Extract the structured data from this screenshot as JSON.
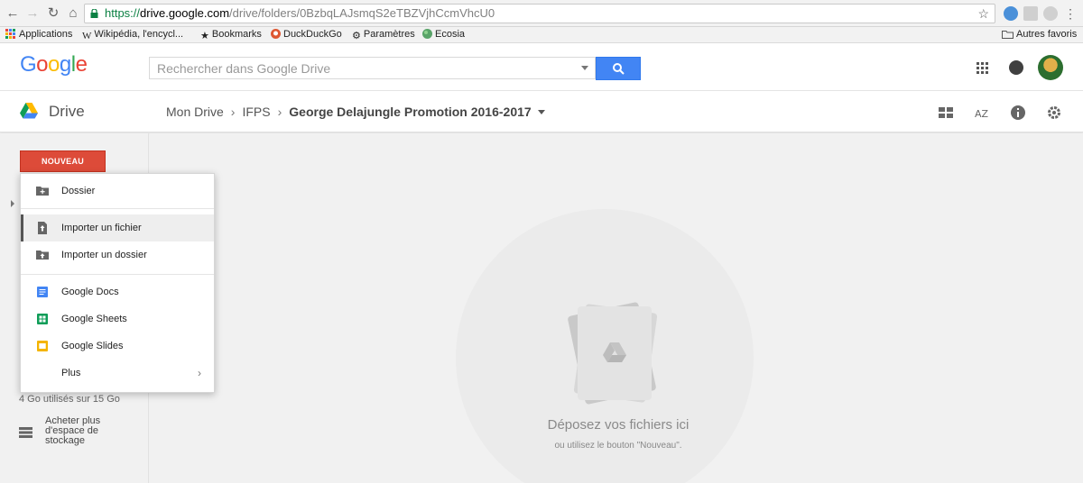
{
  "browser": {
    "url_proto": "https://",
    "url_host": "drive.google.com",
    "url_path": "/drive/folders/0BzbqLAJsmqS2eTBZVjhCcmVhcU0",
    "bookmarks": [
      "Applications",
      "Wikipédia, l'encycl...",
      "Bookmarks",
      "DuckDuckGo",
      "Paramètres",
      "Ecosia"
    ],
    "other_bookmarks": "Autres favoris"
  },
  "header": {
    "logo": "Google",
    "search_placeholder": "Rechercher dans Google Drive"
  },
  "drive": {
    "label": "Drive",
    "breadcrumb": [
      "Mon Drive",
      "IFPS",
      "George Delajungle Promotion 2016-2017"
    ]
  },
  "sidebar": {
    "new_button": "NOUVEAU",
    "storage": "4 Go utilisés sur 15 Go",
    "buy_storage": "Acheter plus d'espace de stockage"
  },
  "menu": {
    "items": [
      {
        "label": "Dossier",
        "icon": "folder-plus-icon"
      },
      {
        "label": "Importer un fichier",
        "icon": "file-upload-icon"
      },
      {
        "label": "Importer un dossier",
        "icon": "folder-upload-icon"
      },
      {
        "label": "Google Docs",
        "icon": "docs-icon"
      },
      {
        "label": "Google Sheets",
        "icon": "sheets-icon"
      },
      {
        "label": "Google Slides",
        "icon": "slides-icon"
      },
      {
        "label": "Plus",
        "icon": "chevron-right-icon"
      }
    ]
  },
  "dropzone": {
    "title": "Déposez vos fichiers ici",
    "subtitle": "ou utilisez le bouton \"Nouveau\"."
  },
  "colors": {
    "new_button": "#dd4b39",
    "search_button": "#4285f4",
    "docs": "#4285f4",
    "sheets": "#0f9d58",
    "slides": "#f4b400"
  }
}
